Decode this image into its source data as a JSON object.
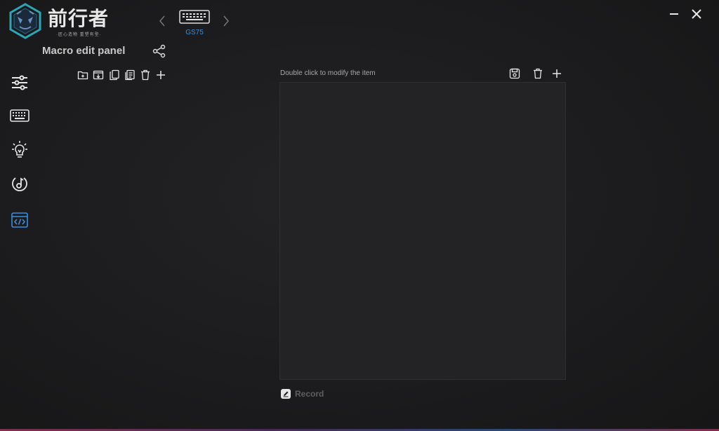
{
  "app": {
    "brand_name": "前行者",
    "brand_tagline": "·匠心造物  重塑有型·"
  },
  "device": {
    "name": "GS75"
  },
  "panel": {
    "title": "Macro edit panel",
    "hint": "Double click to modify the item",
    "record_label": "Record"
  },
  "sidebar": {
    "items": [
      {
        "icon": "sliders-icon"
      },
      {
        "icon": "keyboard-icon"
      },
      {
        "icon": "lightbulb-icon"
      },
      {
        "icon": "music-icon"
      },
      {
        "icon": "code-window-icon",
        "active": true
      }
    ]
  },
  "colors": {
    "accent": "#3a8ee0",
    "background": "#1c1c1e",
    "editor_bg": "#232325"
  }
}
